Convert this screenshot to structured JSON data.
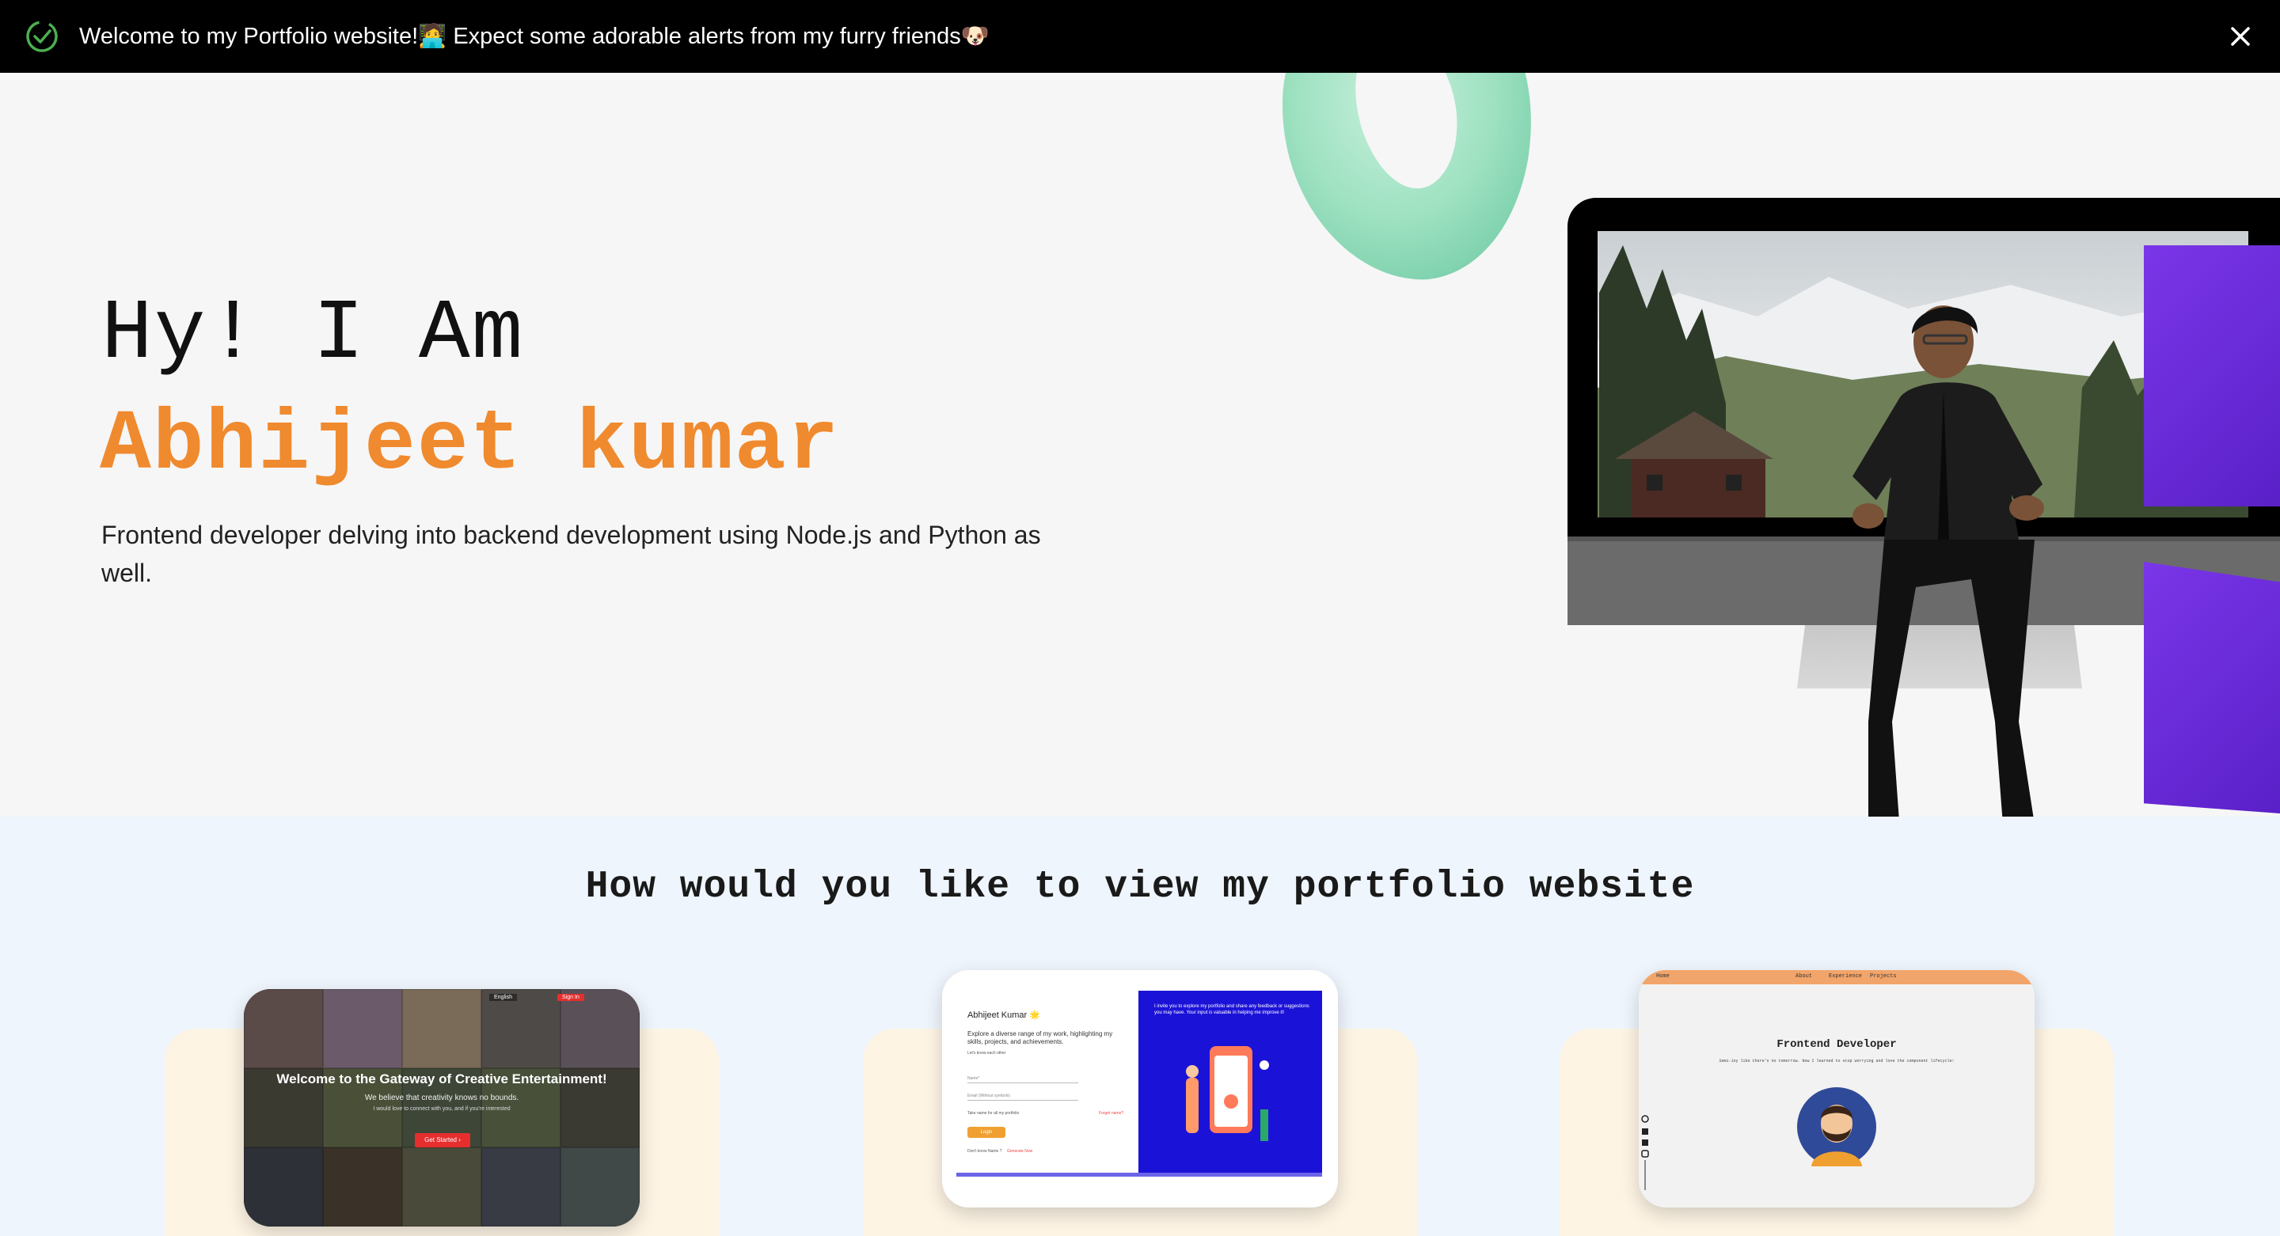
{
  "toast": {
    "message": "Welcome to my Portfolio website!🧑‍💻 Expect some adorable alerts from my furry friends🐶",
    "check_icon": "check-circle-icon",
    "close_icon": "close-icon",
    "accent": "#4caf50"
  },
  "hero": {
    "greeting": "Hy! I Am",
    "name": "Abhijeet kumar",
    "description": "Frontend developer delving into backend development using Node.js and Python as well.",
    "name_color": "#f08a2e"
  },
  "view_section": {
    "title": "How would you like to view my portfolio website",
    "options": [
      {
        "id": "entertainment",
        "preview": {
          "title": "Welcome to the Gateway of Creative Entertainment!",
          "subtitle": "We believe that creativity knows no bounds.",
          "small": "I would love to connect with you, and if you're interested",
          "button": "Get Started ›",
          "lang": "English",
          "signin": "Sign In"
        }
      },
      {
        "id": "form",
        "preview": {
          "name": "Abhijeet Kumar 🌟",
          "text": "Explore a diverse range of my work, highlighting my skills, projects, and achievements.",
          "tiny": "Let's know each other",
          "field1": "Name*",
          "field2": "Email (Without symbols)",
          "checkbox": "Take name for all my portfolio",
          "forgot": "Forgot name?",
          "button": "Login",
          "footer": "Don't know Name ?",
          "footer_link": "Generate Now",
          "right_text": "I invite you to explore my portfolio and share any feedback or suggestions you may have. Your input is valuable in helping me improve it!"
        }
      },
      {
        "id": "developer",
        "preview": {
          "nav_home": "Home",
          "nav_about": "About",
          "nav_experience": "Experience",
          "nav_projects": "Projects",
          "title": "Frontend Developer",
          "subtitle": "Semi-Joy like there's no tomorrow. Now I learned to stop worrying and love the component lifecycle!"
        }
      }
    ]
  }
}
